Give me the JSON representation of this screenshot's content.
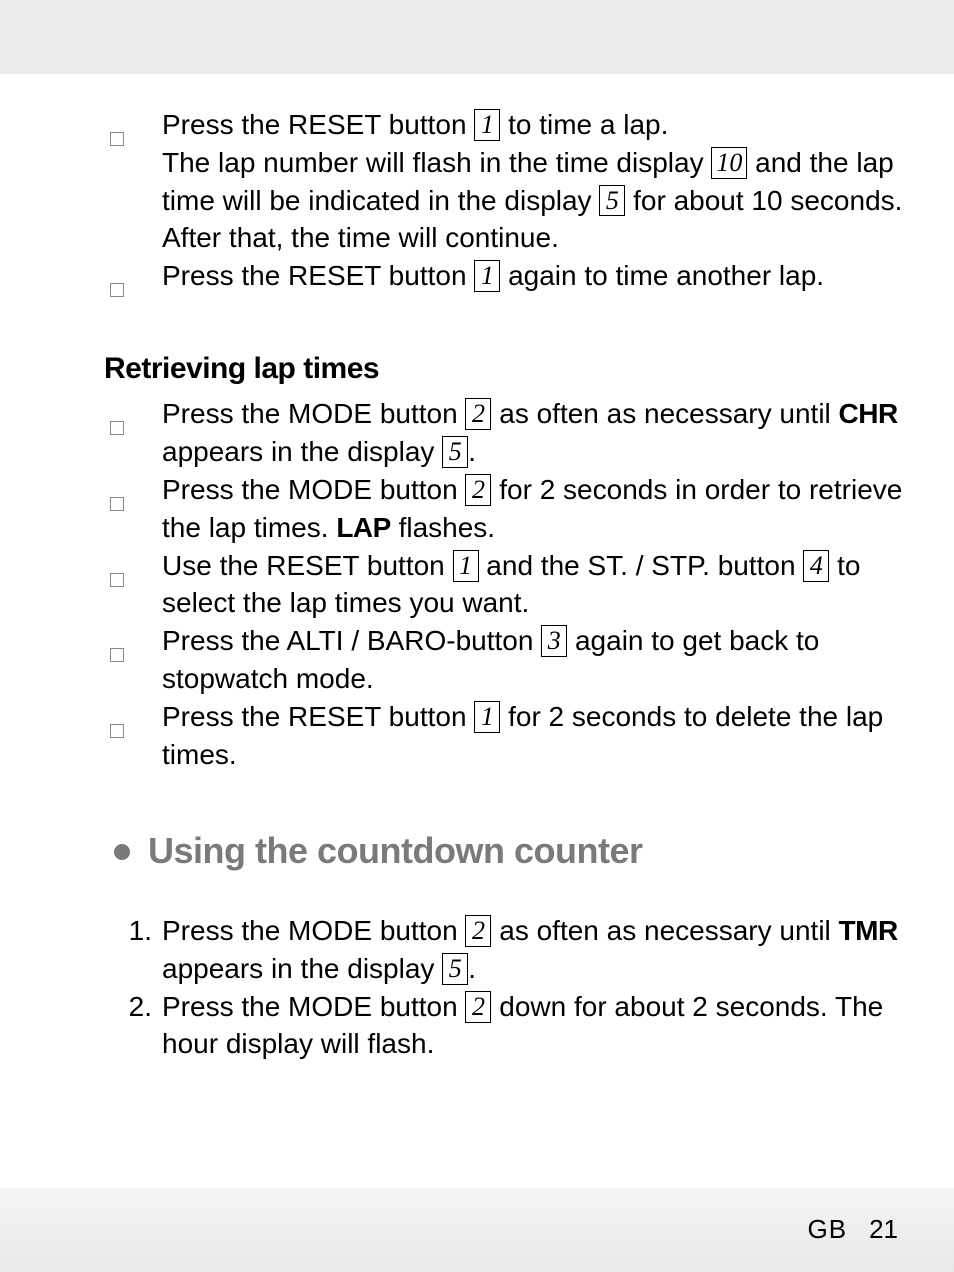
{
  "intro_items": [
    {
      "segments": [
        {
          "t": "Press the RESET button "
        },
        {
          "box": "1"
        },
        {
          "t": " to time a lap.\nThe lap number will flash in the time display "
        },
        {
          "box": "10",
          "wide": true
        },
        {
          "t": " and the lap time will be indicated in the display "
        },
        {
          "box": "5"
        },
        {
          "t": " for about 10 seconds. After that, the time will continue."
        }
      ]
    },
    {
      "segments": [
        {
          "t": "Press the RESET button "
        },
        {
          "box": "1"
        },
        {
          "t": " again to time another lap."
        }
      ]
    }
  ],
  "subheading_retrieve": "Retrieving lap times",
  "retrieve_items": [
    {
      "segments": [
        {
          "t": "Press the MODE button "
        },
        {
          "box": "2"
        },
        {
          "t": " as often as necessary until "
        },
        {
          "bold": "CHR"
        },
        {
          "t": " appears in the display "
        },
        {
          "box": "5"
        },
        {
          "t": "."
        }
      ]
    },
    {
      "segments": [
        {
          "t": "Press the MODE button "
        },
        {
          "box": "2"
        },
        {
          "t": " for 2 seconds in order to retrieve the lap times. "
        },
        {
          "bold": "LAP"
        },
        {
          "t": " flashes."
        }
      ]
    },
    {
      "segments": [
        {
          "t": "Use the RESET button "
        },
        {
          "box": "1"
        },
        {
          "t": " and the ST. / STP. button "
        },
        {
          "box": "4"
        },
        {
          "t": " to select the lap times you want."
        }
      ]
    },
    {
      "segments": [
        {
          "t": "Press the ALTI / BARO-button "
        },
        {
          "box": "3"
        },
        {
          "t": " again to get back to stopwatch mode."
        }
      ]
    },
    {
      "segments": [
        {
          "t": "Press the RESET button "
        },
        {
          "box": "1"
        },
        {
          "t": " for 2 seconds to delete the lap times."
        }
      ]
    }
  ],
  "section_title": "Using the countdown counter",
  "numbered_items": [
    {
      "num": "1.",
      "segments": [
        {
          "t": "Press the MODE button "
        },
        {
          "box": "2"
        },
        {
          "t": " as often as necessary until "
        },
        {
          "bold": "TMR"
        },
        {
          "t": " appears in the display "
        },
        {
          "box": "5"
        },
        {
          "t": "."
        }
      ]
    },
    {
      "num": "2.",
      "segments": [
        {
          "t": "Press the MODE button "
        },
        {
          "box": "2"
        },
        {
          "t": " down for about 2 seconds. The hour display will flash."
        }
      ]
    }
  ],
  "footer": {
    "region": "GB",
    "page": "21"
  }
}
